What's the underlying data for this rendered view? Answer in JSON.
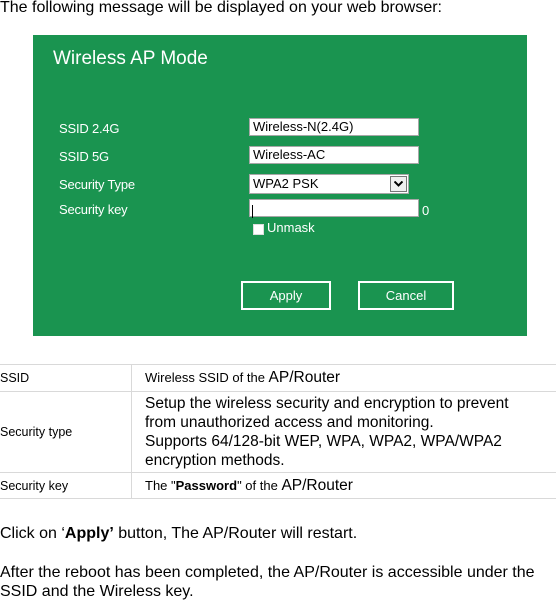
{
  "intro_text": "The following message will be displayed on your web browser:",
  "panel": {
    "title": "Wireless AP Mode",
    "bg_color": "#1a9450",
    "fields": {
      "ssid_24": {
        "label": "SSID 2.4G",
        "value": "Wireless-N(2.4G)"
      },
      "ssid_5": {
        "label": "SSID 5G",
        "value": "Wireless-AC"
      },
      "security_type": {
        "label": "Security Type",
        "value": "WPA2  PSK",
        "icon": "chevron-down-icon"
      },
      "security_key": {
        "label": "Security key",
        "value": "",
        "char_count": "0"
      }
    },
    "unmask_label": "Unmask",
    "unmask_checked": false,
    "apply_label": "Apply",
    "cancel_label": "Cancel"
  },
  "table": {
    "rows": [
      {
        "key": "SSID",
        "value_prefix": "Wireless SSID of the ",
        "value_suffix": "AP/Router"
      },
      {
        "key": "Security type",
        "lines": [
          "Setup the wireless security and encryption to prevent",
          "from unauthorized access and monitoring.",
          "Supports 64/128-bit WEP, WPA, WPA2, WPA/WPA2",
          "encryption methods."
        ]
      },
      {
        "key": "Security key",
        "value_prefix": "The \"",
        "value_bold": "Password",
        "value_mid": "\" of the ",
        "value_suffix": "AP/Router"
      }
    ]
  },
  "para1": {
    "prefix": "Click on ‘",
    "bold": "Apply’",
    "suffix": " button, The AP/Router will restart."
  },
  "para2": {
    "line1": "After the reboot has been completed, the AP/Router is accessible under the",
    "line2": "SSID and the Wireless key."
  }
}
